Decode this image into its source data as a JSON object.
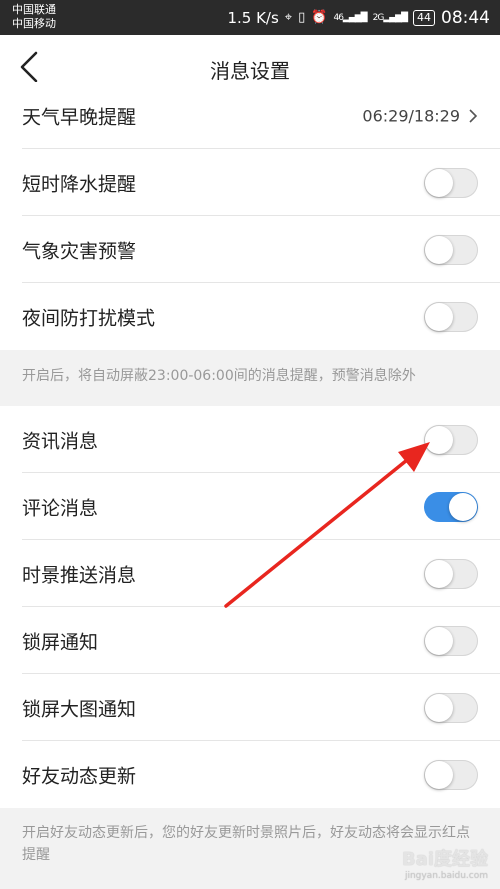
{
  "status_bar": {
    "carrier1": "中国联通",
    "carrier2": "中国移动",
    "speed": "1.5 K/s",
    "signal1": "46",
    "signal2": "2G",
    "battery": "44",
    "time": "08:44"
  },
  "header": {
    "title": "消息设置"
  },
  "rows": [
    {
      "label": "天气早晚提醒",
      "value": "06:29/18:29"
    },
    {
      "label": "短时降水提醒",
      "on": false
    },
    {
      "label": "气象灾害预警",
      "on": false
    },
    {
      "label": "夜间防打扰模式",
      "on": false
    },
    {
      "label": "资讯消息",
      "on": false
    },
    {
      "label": "评论消息",
      "on": true
    },
    {
      "label": "时景推送消息",
      "on": false
    },
    {
      "label": "锁屏通知",
      "on": false
    },
    {
      "label": "锁屏大图通知",
      "on": false
    },
    {
      "label": "好友动态更新",
      "on": false
    }
  ],
  "notes": {
    "dnd": "开启后，将自动屏蔽23:00-06:00间的消息提醒，预警消息除外",
    "friends": "开启好友动态更新后，您的好友更新时景照片后，好友动态将会显示红点提醒"
  },
  "watermark": {
    "brand": "Bai度经验",
    "url": "jingyan.baidu.com"
  },
  "colors": {
    "accent": "#3a8ee6",
    "arrow": "#e8261f"
  }
}
